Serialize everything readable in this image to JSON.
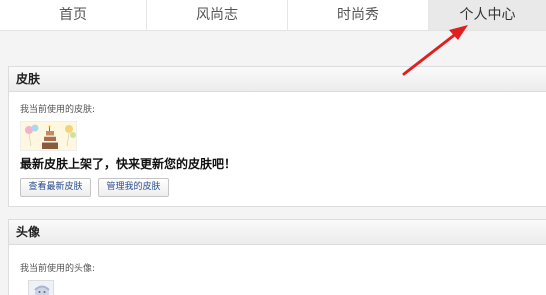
{
  "nav": {
    "tabs": [
      {
        "label": "首页"
      },
      {
        "label": "风尚志"
      },
      {
        "label": "时尚秀"
      },
      {
        "label": "个人中心"
      }
    ]
  },
  "skin_section": {
    "title": "皮肤",
    "current_label": "我当前使用的皮肤:",
    "promo_text": "最新皮肤上架了，快来更新您的皮肤吧！",
    "buttons": {
      "view_new": "查看最新皮肤",
      "manage": "管理我的皮肤"
    }
  },
  "avatar_section": {
    "title": "头像",
    "current_label": "我当前使用的头像:"
  },
  "colors": {
    "annotation_arrow": "#e02020",
    "active_tab_bg": "#e9e9e9",
    "button_text": "#2a4d8f"
  },
  "icons": {
    "annotation": "red-arrow-icon",
    "skin_preview": "birthday-cake-icon",
    "avatar": "cartoon-avatar-icon"
  }
}
